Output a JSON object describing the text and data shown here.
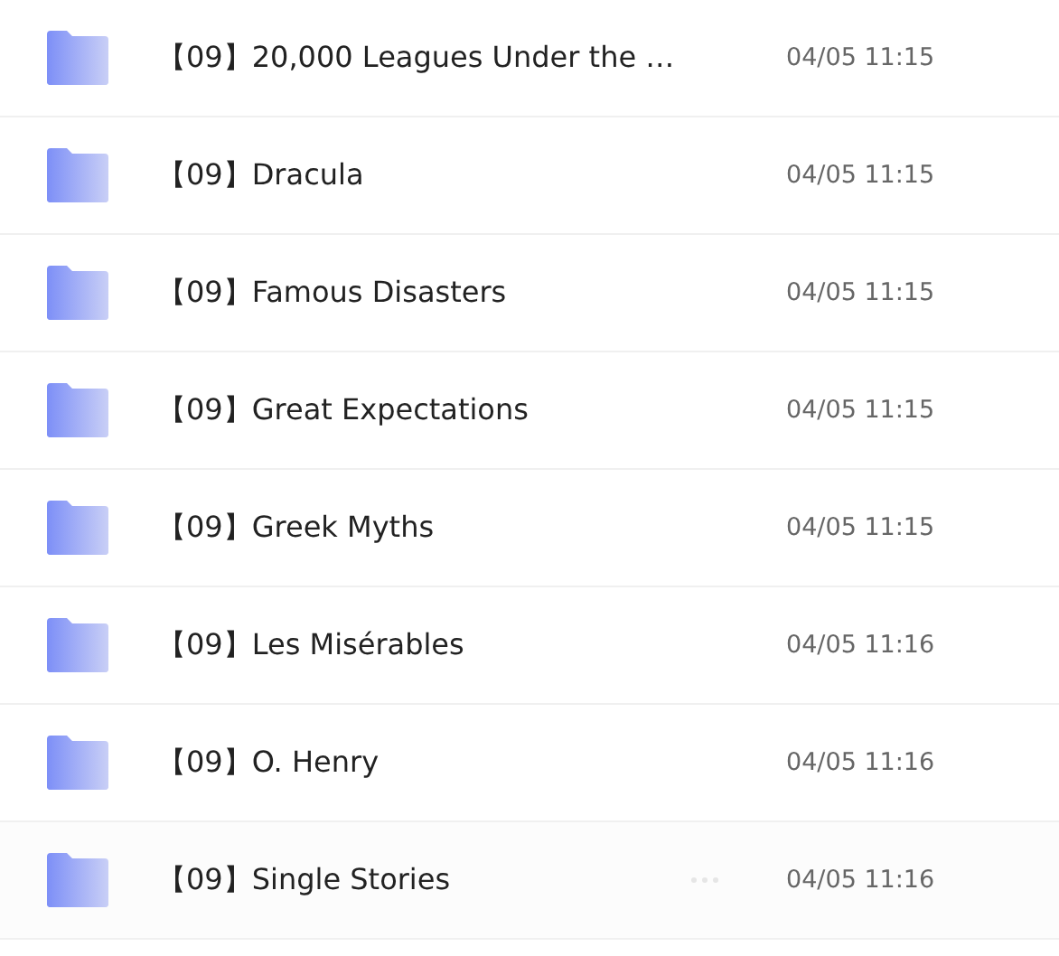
{
  "files": [
    {
      "name": "【09】20,000 Leagues Under the …",
      "modified": "04/05 11:15",
      "hovered": false
    },
    {
      "name": "【09】Dracula",
      "modified": "04/05 11:15",
      "hovered": false
    },
    {
      "name": "【09】Famous Disasters",
      "modified": "04/05 11:15",
      "hovered": false
    },
    {
      "name": "【09】Great Expectations",
      "modified": "04/05 11:15",
      "hovered": false
    },
    {
      "name": "【09】Greek Myths",
      "modified": "04/05 11:15",
      "hovered": false
    },
    {
      "name": "【09】Les Misérables",
      "modified": "04/05 11:16",
      "hovered": false
    },
    {
      "name": "【09】O. Henry",
      "modified": "04/05 11:16",
      "hovered": false
    },
    {
      "name": "【09】Single Stories",
      "modified": "04/05 11:16",
      "hovered": true
    }
  ]
}
